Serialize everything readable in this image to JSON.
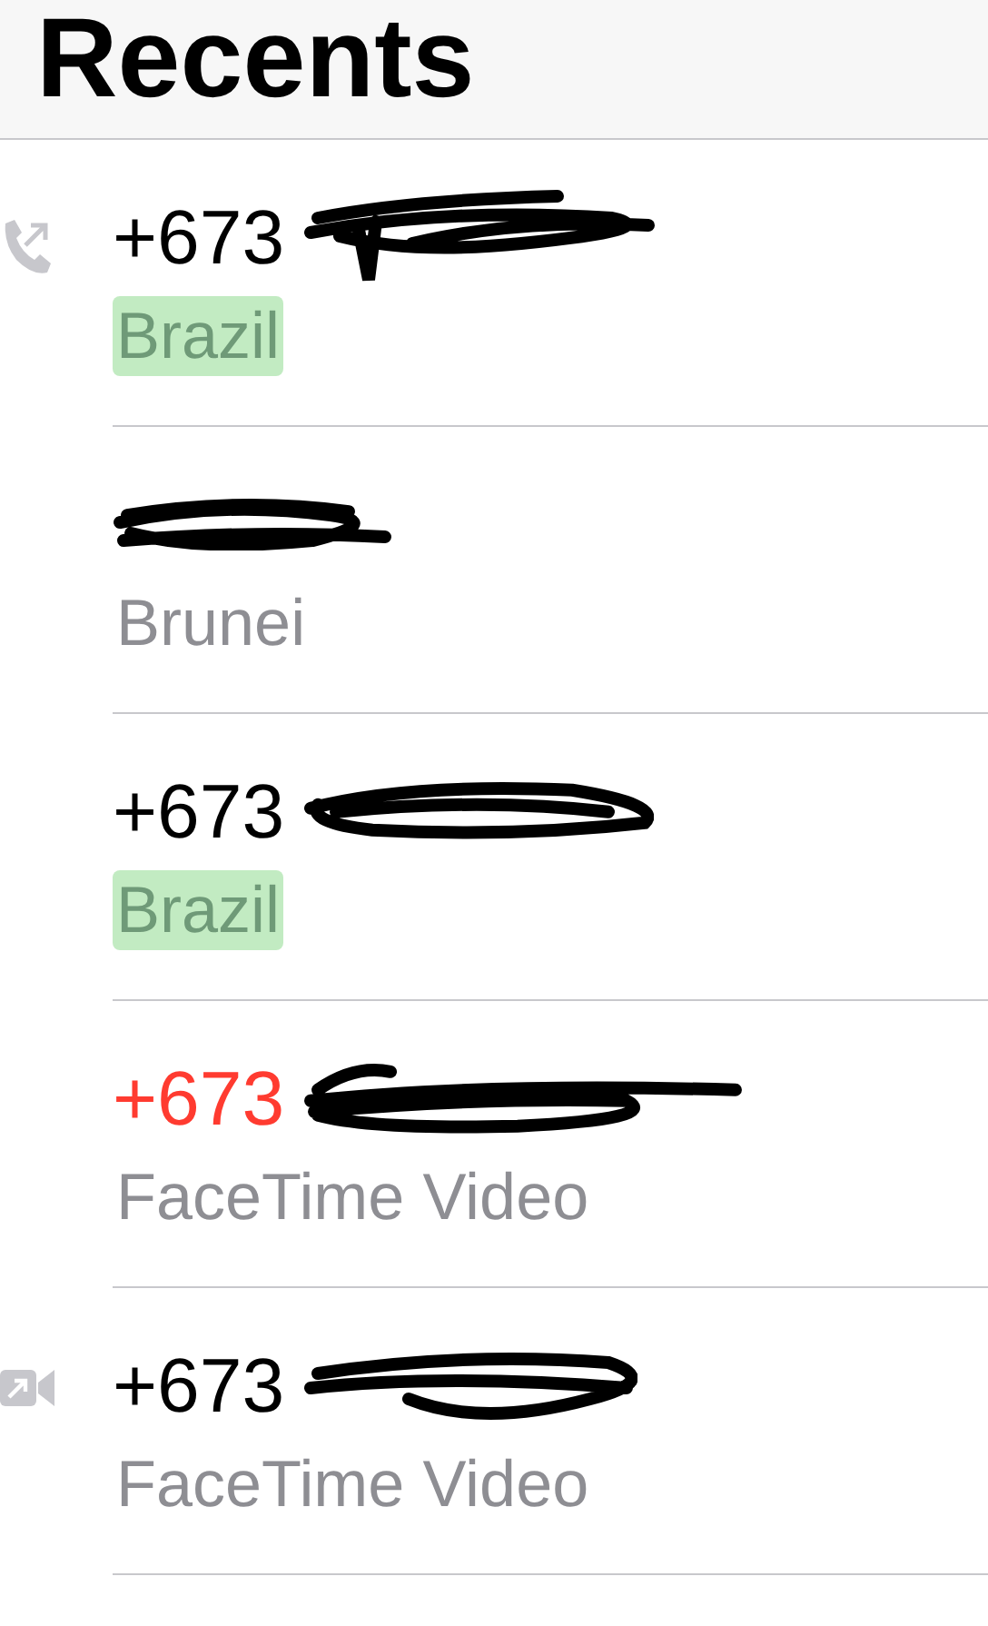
{
  "title": "Recents",
  "calls": [
    {
      "number": "+673",
      "label": "Brazil",
      "missed": false,
      "highlighted": true,
      "kind": "outgoing-call"
    },
    {
      "label": "Brunei",
      "highlighted": false,
      "kind": "plain"
    },
    {
      "number": "+673",
      "label": "Brazil",
      "missed": false,
      "highlighted": true,
      "kind": "plain"
    },
    {
      "number": "+673",
      "label": "FaceTime Video",
      "missed": true,
      "highlighted": false,
      "kind": "plain"
    },
    {
      "number": "+673",
      "label": "FaceTime Video",
      "missed": false,
      "highlighted": false,
      "kind": "outgoing-video"
    }
  ]
}
